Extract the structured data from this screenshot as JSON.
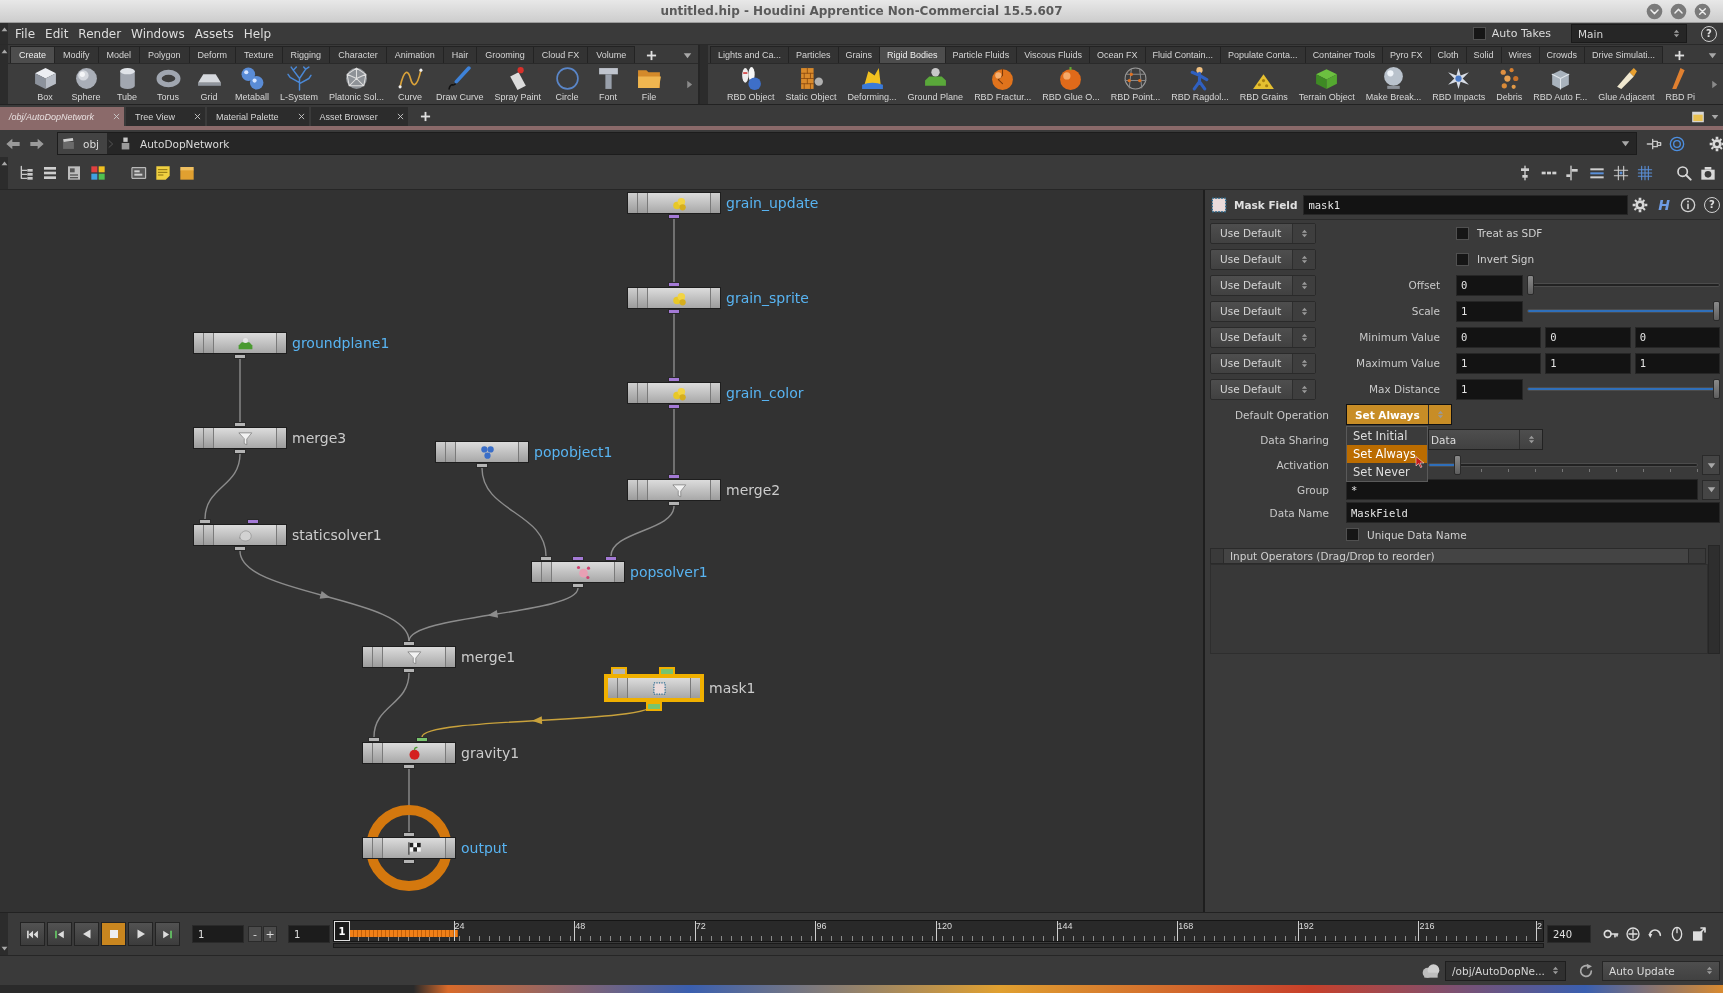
{
  "window": {
    "title": "untitled.hip - Houdini Apprentice Non-Commercial 15.5.607"
  },
  "menu_bar": {
    "items": [
      "File",
      "Edit",
      "Render",
      "Windows",
      "Assets",
      "Help"
    ],
    "auto_takes": {
      "label": "Auto Takes",
      "checked": false
    },
    "desktop": "Main",
    "help_button": "?"
  },
  "shelves": [
    {
      "tabs": [
        {
          "label": "Create",
          "selected": true
        },
        {
          "label": "Modify",
          "selected": false
        },
        {
          "label": "Model",
          "selected": false
        },
        {
          "label": "Polygon",
          "selected": false
        },
        {
          "label": "Deform",
          "selected": false
        },
        {
          "label": "Texture",
          "selected": false
        },
        {
          "label": "Rigging",
          "selected": false
        },
        {
          "label": "Character",
          "selected": false
        },
        {
          "label": "Animation",
          "selected": false
        },
        {
          "label": "Hair",
          "selected": false
        },
        {
          "label": "Grooming",
          "selected": false
        },
        {
          "label": "Cloud FX",
          "selected": false
        },
        {
          "label": "Volume",
          "selected": false
        }
      ],
      "tools": [
        "Box",
        "Sphere",
        "Tube",
        "Torus",
        "Grid",
        "Metaball",
        "L-System",
        "Platonic Sol...",
        "Curve",
        "Draw Curve",
        "Spray Paint",
        "Circle",
        "Font",
        "File"
      ]
    },
    {
      "tabs": [
        {
          "label": "Lights and Ca...",
          "selected": false
        },
        {
          "label": "Particles",
          "selected": false
        },
        {
          "label": "Grains",
          "selected": false
        },
        {
          "label": "Rigid Bodies",
          "selected": true
        },
        {
          "label": "Particle Fluids",
          "selected": false
        },
        {
          "label": "Viscous Fluids",
          "selected": false
        },
        {
          "label": "Ocean FX",
          "selected": false
        },
        {
          "label": "Fluid Contain...",
          "selected": false
        },
        {
          "label": "Populate Conta...",
          "selected": false
        },
        {
          "label": "Container Tools",
          "selected": false
        },
        {
          "label": "Pyro FX",
          "selected": false
        },
        {
          "label": "Cloth",
          "selected": false
        },
        {
          "label": "Solid",
          "selected": false
        },
        {
          "label": "Wires",
          "selected": false
        },
        {
          "label": "Crowds",
          "selected": false
        },
        {
          "label": "Drive Simulati...",
          "selected": false
        }
      ],
      "tools": [
        "RBD Object",
        "Static Object",
        "Deforming...",
        "Ground Plane",
        "RBD Fractur...",
        "RBD Glue O...",
        "RBD Point...",
        "RBD Ragdol...",
        "RBD Grains",
        "Terrain Object",
        "Make Break...",
        "RBD Impacts",
        "Debris",
        "RBD Auto F...",
        "Glue Adjacent",
        "RBD Pi"
      ]
    }
  ],
  "pane_tabs": [
    {
      "label": "/obj/AutoDopNetwork",
      "selected": true
    },
    {
      "label": "Tree View",
      "selected": false
    },
    {
      "label": "Material Palette",
      "selected": false
    },
    {
      "label": "Asset Browser",
      "selected": false
    }
  ],
  "path_bar": {
    "crumbs": [
      "obj",
      "AutoDopNetwork"
    ]
  },
  "network": {
    "nodes": [
      {
        "name": "grain_update",
        "kind": "grain",
        "color": "#58b4f2",
        "selected": false,
        "displayed": false
      },
      {
        "name": "grain_sprite",
        "kind": "grain",
        "color": "#58b4f2",
        "selected": false,
        "displayed": false
      },
      {
        "name": "groundplane1",
        "kind": "ground",
        "color": "#58b4f2",
        "selected": false,
        "displayed": false
      },
      {
        "name": "grain_color",
        "kind": "grain",
        "color": "#58b4f2",
        "selected": false,
        "displayed": false
      },
      {
        "name": "merge3",
        "kind": "merge",
        "color": "#cccccc",
        "selected": false,
        "displayed": false
      },
      {
        "name": "popobject1",
        "kind": "pop_object",
        "color": "#58b4f2",
        "selected": false,
        "displayed": false
      },
      {
        "name": "merge2",
        "kind": "merge",
        "color": "#cccccc",
        "selected": false,
        "displayed": false
      },
      {
        "name": "staticsolver1",
        "kind": "static_solver",
        "color": "#cccccc",
        "selected": false,
        "displayed": false
      },
      {
        "name": "popsolver1",
        "kind": "pop_solver",
        "color": "#58b4f2",
        "selected": false,
        "displayed": false
      },
      {
        "name": "merge1",
        "kind": "merge",
        "color": "#cccccc",
        "selected": false,
        "displayed": false
      },
      {
        "name": "mask1",
        "kind": "mask",
        "color": "#cccccc",
        "selected": true,
        "displayed": false
      },
      {
        "name": "gravity1",
        "kind": "gravity",
        "color": "#cccccc",
        "selected": false,
        "displayed": false
      },
      {
        "name": "output",
        "kind": "output",
        "color": "#58b4f2",
        "selected": false,
        "displayed": true
      }
    ]
  },
  "parameters": {
    "type": "Mask Field",
    "name": "mask1",
    "header_buttons": [
      {
        "kind": "settings"
      },
      {
        "kind": "letter",
        "text": "H"
      },
      {
        "kind": "info"
      },
      {
        "kind": "circled",
        "text": "?"
      }
    ],
    "rows": [
      {
        "kind": "toggle",
        "override": "Use Default",
        "label": "Treat as SDF",
        "checked": false
      },
      {
        "kind": "toggle",
        "override": "Use Default",
        "label": "Invert Sign",
        "checked": false
      },
      {
        "kind": "slider",
        "override": "Use Default",
        "label": "Offset",
        "value": "0",
        "level": 0
      },
      {
        "kind": "slider",
        "override": "Use Default",
        "label": "Scale",
        "value": "1",
        "level": 1
      },
      {
        "kind": "vector",
        "override": "Use Default",
        "label": "Minimum Value",
        "values": [
          "0",
          "0",
          "0"
        ]
      },
      {
        "kind": "vector",
        "override": "Use Default",
        "label": "Maximum Value",
        "values": [
          "1",
          "1",
          "1"
        ]
      },
      {
        "kind": "slider",
        "override": "Use Default",
        "label": "Max Distance",
        "value": "1",
        "level": 1
      },
      {
        "kind": "menu",
        "label": "Default Operation",
        "value": "Set Always",
        "open": true,
        "options": [
          {
            "label": "Set Initial",
            "selected": false
          },
          {
            "label": "Set Always",
            "selected": true
          },
          {
            "label": "Set Never",
            "selected": false
          }
        ]
      },
      {
        "kind": "menu",
        "label": "Data Sharing",
        "value": "Data",
        "open": false
      },
      {
        "kind": "slider",
        "label": "Activation",
        "level": 0.1,
        "menu": true
      },
      {
        "kind": "string",
        "label": "Group",
        "value": "*",
        "menu": true
      },
      {
        "kind": "string",
        "label": "Data Name",
        "value": "MaskField"
      },
      {
        "kind": "toggle",
        "label": "Unique Data Name",
        "checked": false
      }
    ],
    "multiparm": {
      "label": "Input Operators (Drag/Drop to reorder)"
    }
  },
  "timeline": {
    "stopped": true,
    "current_frame": "1",
    "step_buttons": [
      "-",
      "+"
    ],
    "start_frame": "1",
    "marker": "1",
    "cache": {
      "level": 0.1
    },
    "ticks": [
      "24",
      "48",
      "72",
      "96",
      "120",
      "144",
      "168",
      "192",
      "216",
      "2"
    ],
    "end_frame": "240"
  },
  "status_bar": {
    "path": "/obj/AutoDopNe...",
    "update_mode": "Auto Update"
  }
}
